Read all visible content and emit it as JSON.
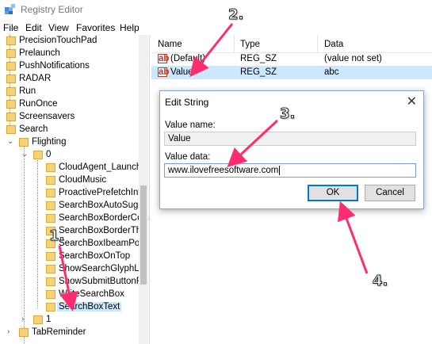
{
  "window": {
    "title": "Registry Editor"
  },
  "menu": [
    "File",
    "Edit",
    "View",
    "Favorites",
    "Help"
  ],
  "tree": {
    "items": [
      "PrecisionTouchPad",
      "Prelaunch",
      "PushNotifications",
      "RADAR",
      "Run",
      "RunOnce",
      "Screensavers",
      "Search",
      "Flighting",
      "0",
      "CloudAgent_Launcha",
      "CloudMusic",
      "ProactivePrefetchInte",
      "SearchBoxAutoSugge",
      "SearchBoxBorderColc",
      "SearchBoxBorderThic",
      "SearchBoxIbeamPoin",
      "SearchBoxOnTop",
      "ShowSearchGlyphLef",
      "ShowSubmitButtonR",
      "WriteSearchBox",
      "SearchBoxText",
      "1",
      "TabReminder"
    ]
  },
  "list": {
    "headers": {
      "name": "Name",
      "type": "Type",
      "data": "Data"
    },
    "rows": [
      {
        "name": "(Default)",
        "type": "REG_SZ",
        "data": "(value not set)"
      },
      {
        "name": "Value",
        "type": "REG_SZ",
        "data": "abc"
      }
    ]
  },
  "dialog": {
    "title": "Edit String",
    "value_name_label": "Value name:",
    "value_name": "Value",
    "value_data_label": "Value data:",
    "value_data": "www.ilovefreesoftware.com",
    "ok_label": "OK",
    "cancel_label": "Cancel"
  },
  "annotations": [
    "1.",
    "2.",
    "3.",
    "4."
  ],
  "colors": {
    "arrow": "#ff2d6f",
    "selection": "#cce8ff",
    "folder": "#f5d27a"
  }
}
